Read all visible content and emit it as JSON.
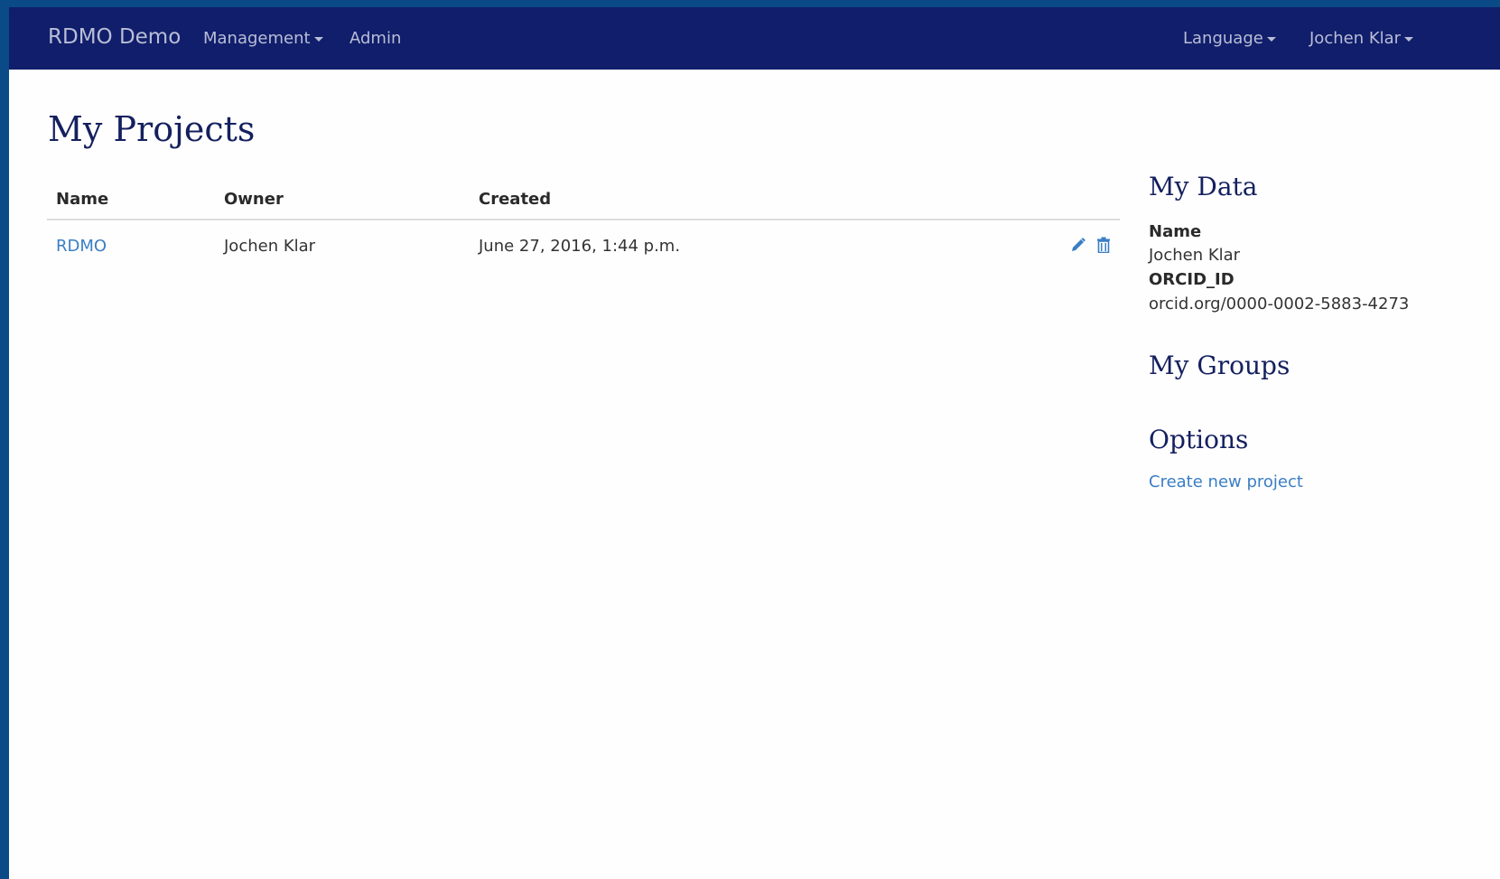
{
  "navbar": {
    "brand": "RDMO Demo",
    "management_label": "Management",
    "admin_label": "Admin",
    "language_label": "Language",
    "user_label": "Jochen Klar"
  },
  "page": {
    "title": "My Projects"
  },
  "projects_table": {
    "headers": [
      "Name",
      "Owner",
      "Created"
    ],
    "rows": [
      {
        "name": "RDMO",
        "owner": "Jochen Klar",
        "created": "June 27, 2016, 1:44 p.m."
      }
    ]
  },
  "sidebar": {
    "my_data_title": "My Data",
    "name_label": "Name",
    "name_value": "Jochen Klar",
    "orcid_label": "ORCID_ID",
    "orcid_value": "orcid.org/0000-0002-5883-4273",
    "my_groups_title": "My Groups",
    "options_title": "Options",
    "create_project_label": "Create new project"
  },
  "icons": {
    "edit": "pencil-icon",
    "delete": "trash-icon"
  },
  "colors": {
    "navbar": "#101e6b",
    "link": "#3a7ec4",
    "heading": "#14205f",
    "frame": "#0a4a86"
  }
}
